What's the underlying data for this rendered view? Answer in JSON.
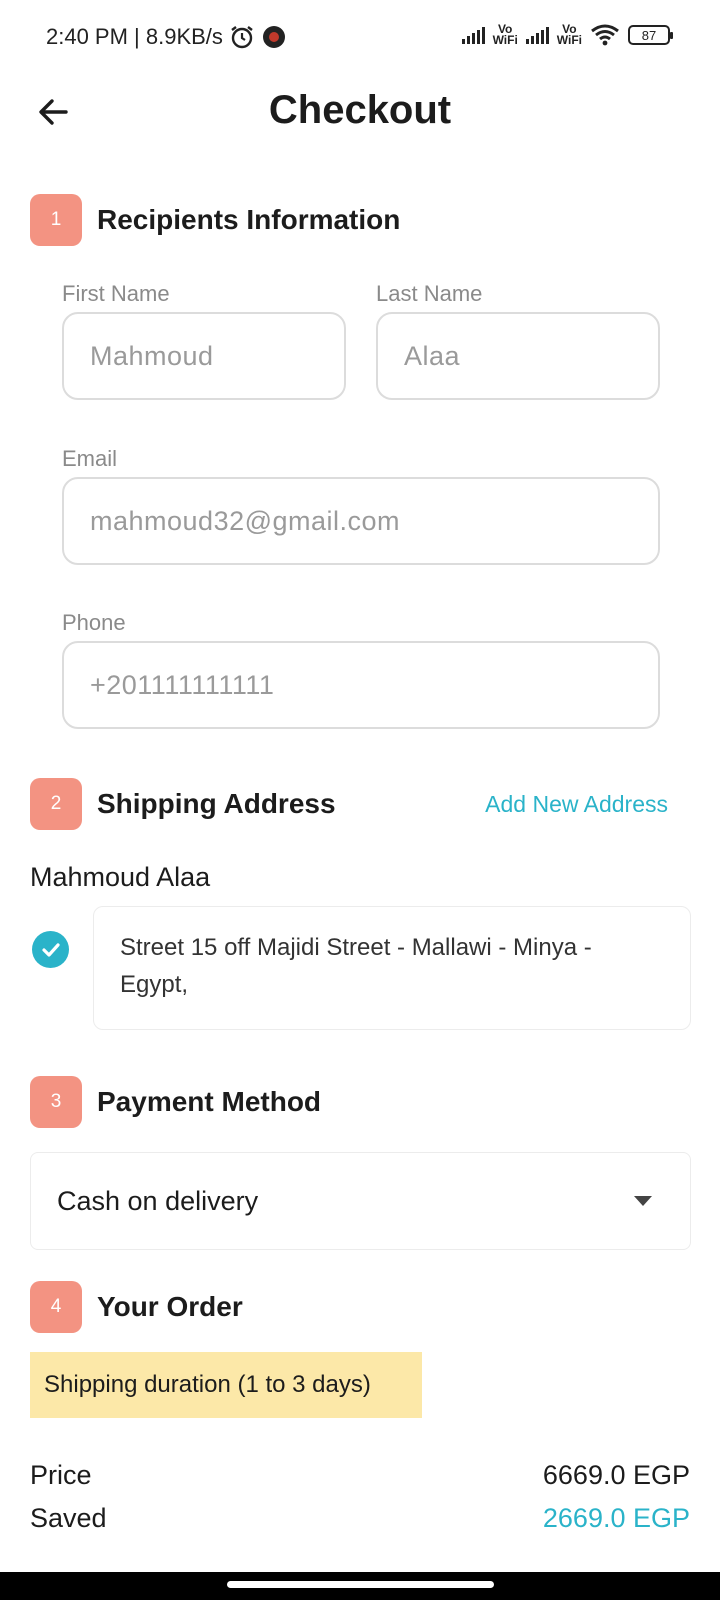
{
  "status_bar": {
    "time_speed": "2:40 PM | 8.9KB/s",
    "vowifi_1": "Vo\nWiFi",
    "vowifi_2": "Vo\nWiFi",
    "battery": "87"
  },
  "header": {
    "title": "Checkout",
    "back_icon": "arrow-left-icon"
  },
  "sections": {
    "recipients": {
      "number": "1",
      "title": "Recipients Information"
    },
    "shipping": {
      "number": "2",
      "title": "Shipping Address",
      "add_link": "Add New Address"
    },
    "payment": {
      "number": "3",
      "title": "Payment Method"
    },
    "order": {
      "number": "4",
      "title": "Your Order"
    }
  },
  "form": {
    "first_name": {
      "label": "First Name",
      "value": "Mahmoud"
    },
    "last_name": {
      "label": "Last Name",
      "value": "Alaa"
    },
    "email": {
      "label": "Email",
      "value": "mahmoud32@gmail.com"
    },
    "phone": {
      "label": "Phone",
      "value": "+201111111111"
    }
  },
  "address": {
    "recipient": "Mahmoud Alaa",
    "text": "Street 15 off Majidi Street - Mallawi - Minya - Egypt,",
    "selected": true
  },
  "payment": {
    "selected": "Cash on delivery"
  },
  "order": {
    "notice": "Shipping duration (1 to 3 days)",
    "price_label": "Price",
    "price_value": "6669.0 EGP",
    "saved_label": "Saved",
    "saved_value": "2669.0 EGP"
  },
  "colors": {
    "accent": "#2ab3c9",
    "step_badge": "#f39382",
    "notice_bg": "#fce8a8"
  }
}
